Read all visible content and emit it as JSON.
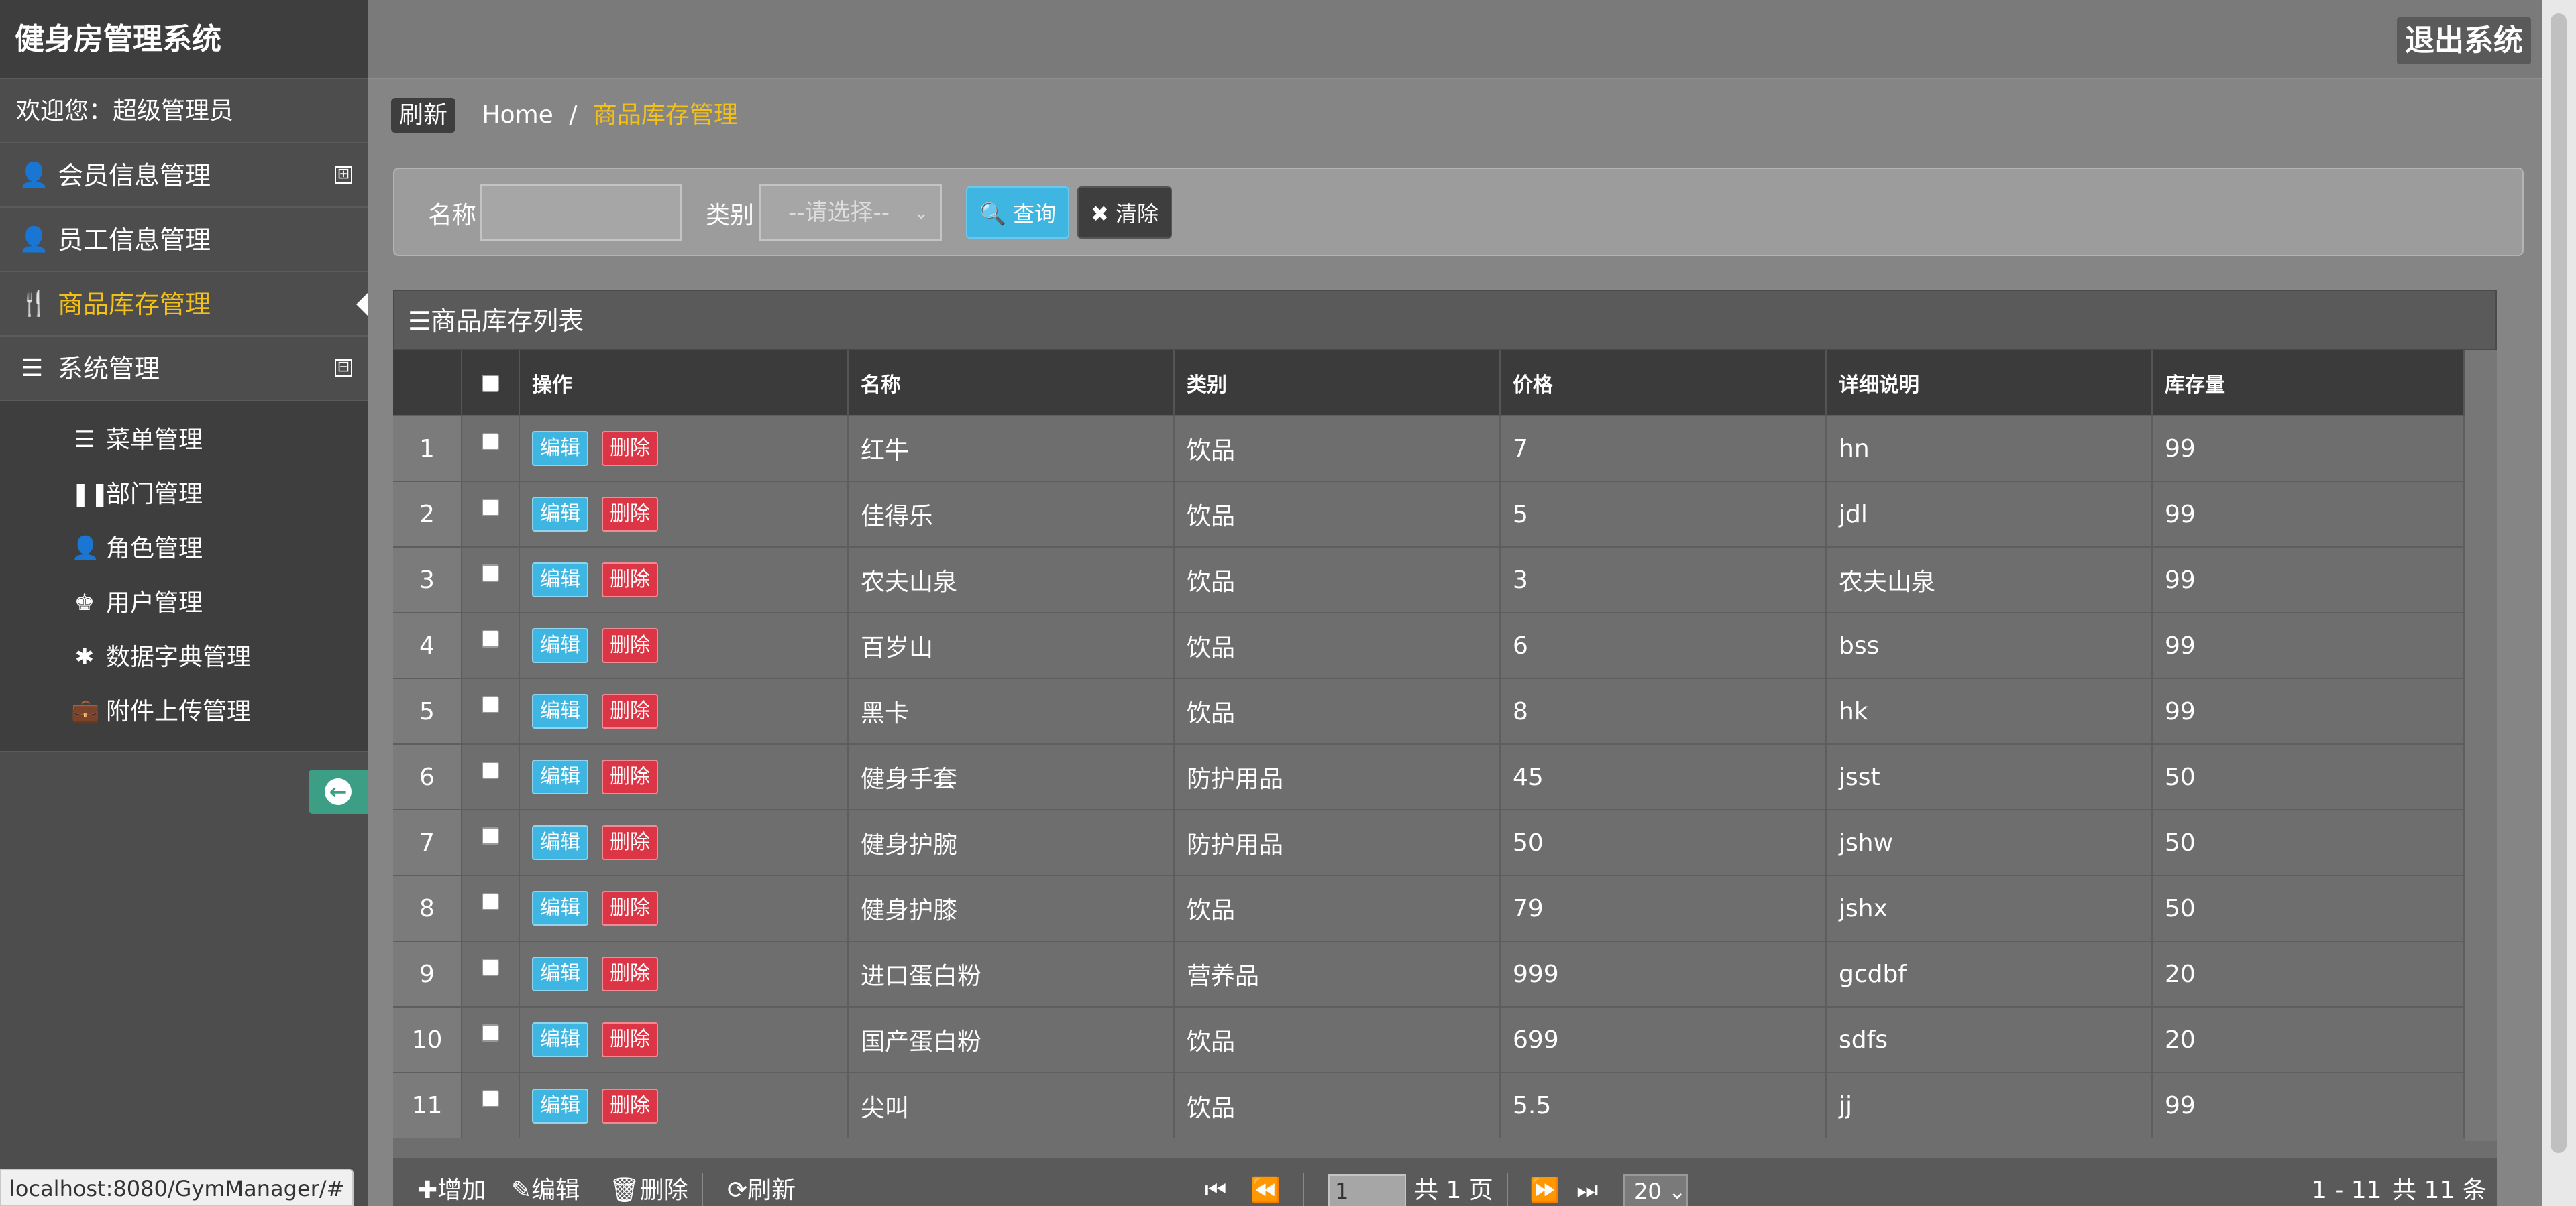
{
  "app": {
    "title": "健身房管理系统",
    "welcome": "欢迎您：超级管理员",
    "logout": "退出系统"
  },
  "sidebar": {
    "items": [
      {
        "label": "会员信息管理",
        "icon": "user-icon",
        "toggle": "⊞"
      },
      {
        "label": "员工信息管理",
        "icon": "user-icon"
      },
      {
        "label": "商品库存管理",
        "icon": "cutlery-icon",
        "active": true
      },
      {
        "label": "系统管理",
        "icon": "list-icon",
        "toggle": "⊟"
      }
    ],
    "subitems": [
      {
        "label": "菜单管理",
        "icon": "list-icon"
      },
      {
        "label": "部门管理",
        "icon": "pause-icon"
      },
      {
        "label": "角色管理",
        "icon": "user-icon"
      },
      {
        "label": "用户管理",
        "icon": "king-icon"
      },
      {
        "label": "数据字典管理",
        "icon": "asterisk-icon"
      },
      {
        "label": "附件上传管理",
        "icon": "briefcase-icon"
      }
    ]
  },
  "breadcrumb": {
    "refresh": "刷新",
    "home": "Home",
    "separator": "/",
    "current": "商品库存管理"
  },
  "search": {
    "name_label": "名称",
    "name_value": "",
    "type_label": "类别",
    "type_placeholder": "--请选择--",
    "query": "查询",
    "clear": "清除"
  },
  "table": {
    "title": "商品库存列表",
    "columns": [
      "操作",
      "名称",
      "类别",
      "价格",
      "详细说明",
      "库存量"
    ],
    "edit_label": "编辑",
    "delete_label": "删除",
    "rows": [
      {
        "no": "1",
        "name": "红牛",
        "type": "饮品",
        "price": "7",
        "desc": "hn",
        "stock": "99"
      },
      {
        "no": "2",
        "name": "佳得乐",
        "type": "饮品",
        "price": "5",
        "desc": "jdl",
        "stock": "99"
      },
      {
        "no": "3",
        "name": "农夫山泉",
        "type": "饮品",
        "price": "3",
        "desc": "农夫山泉",
        "stock": "99"
      },
      {
        "no": "4",
        "name": "百岁山",
        "type": "饮品",
        "price": "6",
        "desc": "bss",
        "stock": "99"
      },
      {
        "no": "5",
        "name": "黑卡",
        "type": "饮品",
        "price": "8",
        "desc": "hk",
        "stock": "99"
      },
      {
        "no": "6",
        "name": "健身手套",
        "type": "防护用品",
        "price": "45",
        "desc": "jsst",
        "stock": "50"
      },
      {
        "no": "7",
        "name": "健身护腕",
        "type": "防护用品",
        "price": "50",
        "desc": "jshw",
        "stock": "50"
      },
      {
        "no": "8",
        "name": "健身护膝",
        "type": "饮品",
        "price": "79",
        "desc": "jshx",
        "stock": "50"
      },
      {
        "no": "9",
        "name": "进口蛋白粉",
        "type": "营养品",
        "price": "999",
        "desc": "gcdbf",
        "stock": "20"
      },
      {
        "no": "10",
        "name": "国产蛋白粉",
        "type": "饮品",
        "price": "699",
        "desc": "sdfs",
        "stock": "20"
      },
      {
        "no": "11",
        "name": "尖叫",
        "type": "饮品",
        "price": "5.5",
        "desc": "jj",
        "stock": "99"
      }
    ]
  },
  "footer": {
    "add": "增加",
    "edit": "编辑",
    "delete": "删除",
    "refresh": "刷新",
    "page_value": "1",
    "total_pages": "共 1 页",
    "page_size": "20",
    "range": "1 - 11",
    "total": "共 11 条"
  },
  "status": {
    "url": "localhost:8080/GymManager/#"
  },
  "colors": {
    "accent": "#f3c019",
    "query": "#3fb6e2",
    "danger": "#dc3545",
    "collapse": "#3d9e86"
  }
}
